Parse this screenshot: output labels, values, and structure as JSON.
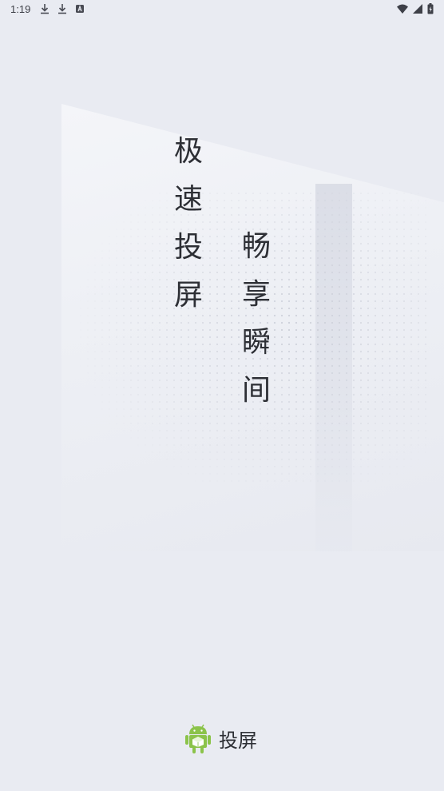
{
  "status_bar": {
    "time": "1:19",
    "icons_left": [
      "download-icon",
      "download-icon",
      "app-notification-icon"
    ],
    "icons_right": [
      "wifi-icon",
      "signal-icon",
      "battery-icon"
    ]
  },
  "slogan": {
    "left_column": [
      "极",
      "速",
      "投",
      "屏"
    ],
    "right_column": [
      "畅",
      "享",
      "瞬",
      "间"
    ]
  },
  "brand": {
    "name": "投屏",
    "logo_icon": "android-logo-icon",
    "logo_color": "#8bc34a"
  },
  "colors": {
    "background": "#e9ebf2",
    "text": "#2d2f35"
  }
}
